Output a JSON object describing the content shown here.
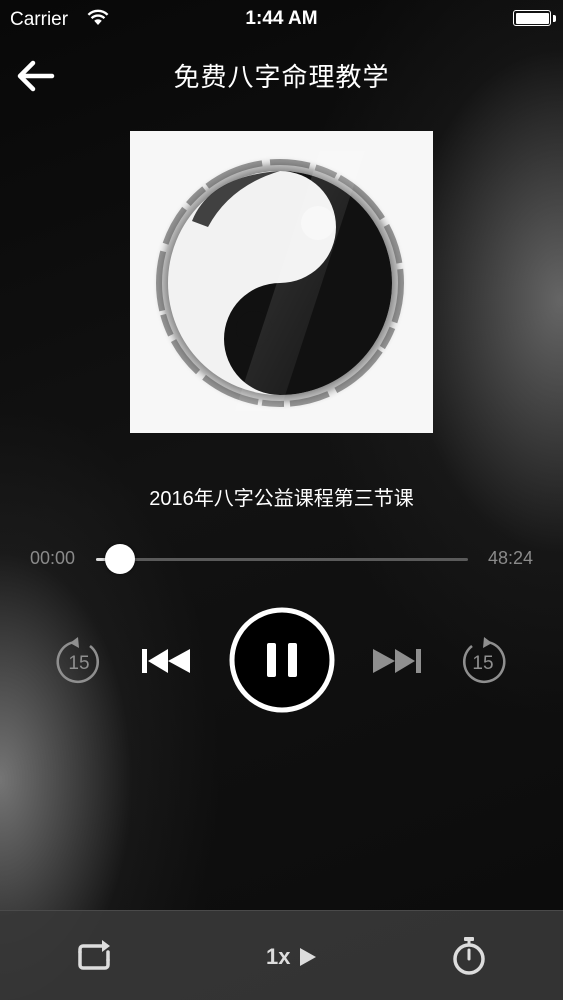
{
  "status_bar": {
    "carrier": "Carrier",
    "time": "1:44 AM",
    "battery_icon": "battery-full-icon",
    "wifi_icon": "wifi-icon"
  },
  "nav": {
    "title": "免费八字命理教学",
    "back_icon": "arrow-left-icon"
  },
  "track": {
    "title": "2016年八字公益课程第三节课",
    "artwork": "yin-yang ink artwork"
  },
  "progress": {
    "elapsed": "00:00",
    "total": "48:24",
    "fraction": 0.03
  },
  "controls": {
    "rewind_label": "15",
    "forward_label": "15",
    "rewind_icon": "rewind-15-icon",
    "previous_icon": "previous-track-icon",
    "pause_icon": "pause-icon",
    "next_icon": "next-track-icon",
    "forward_icon": "forward-15-icon"
  },
  "bottom_bar": {
    "repeat_icon": "repeat-icon",
    "speed_label": "1x",
    "speed_icon": "play-triangle-icon",
    "timer_icon": "stopwatch-icon"
  },
  "colors": {
    "background": "#050505",
    "accent": "#ffffff",
    "muted_text": "#8a8a8a",
    "bottom_bar": "#373737"
  }
}
